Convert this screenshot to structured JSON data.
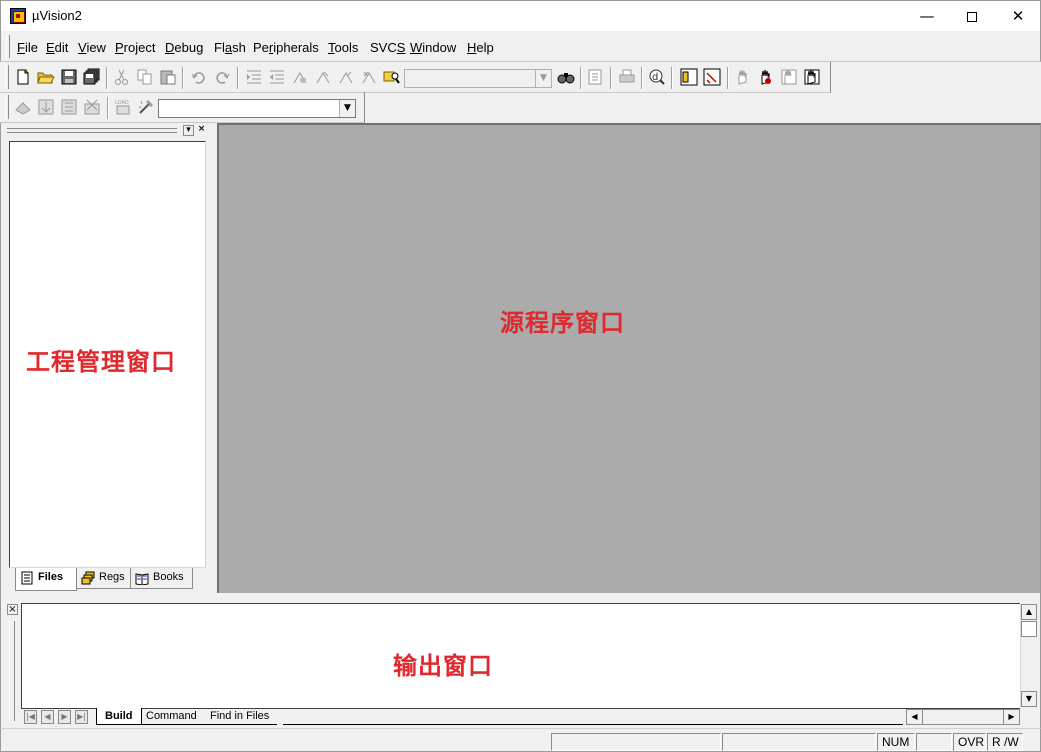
{
  "window": {
    "title": "µVision2",
    "min_glyph": "—",
    "close_glyph": "✕"
  },
  "menu": [
    {
      "key": "F",
      "rest": "ile"
    },
    {
      "key": "E",
      "rest": "dit"
    },
    {
      "key": "V",
      "rest": "iew"
    },
    {
      "key": "P",
      "rest": "roject"
    },
    {
      "key": "D",
      "rest": "ebug"
    },
    {
      "pre": "Fl",
      "key": "a",
      "rest": "sh"
    },
    {
      "pre": "Pe",
      "key": "r",
      "rest": "ipherals"
    },
    {
      "key": "T",
      "rest": "ools"
    },
    {
      "pre": "SVC",
      "key": "S",
      "rest": ""
    },
    {
      "key": "W",
      "rest": "indow"
    },
    {
      "key": "H",
      "rest": "elp"
    }
  ],
  "toolbar": {
    "find_combo_value": "",
    "target_combo_value": "",
    "combo_arrow": "▼"
  },
  "project_panel": {
    "tabs": [
      {
        "label": "Files"
      },
      {
        "label": "Regs"
      },
      {
        "label": "Books"
      }
    ],
    "float_glyph": "▾",
    "close_glyph": "×"
  },
  "labels": {
    "project_window": "工程管理窗口",
    "source_window": "源程序窗口",
    "output_window": "输出窗口"
  },
  "output_panel": {
    "close_glyph": "×",
    "tabs": [
      {
        "label": "Build"
      },
      {
        "label": "Command"
      },
      {
        "label": "Find in Files"
      }
    ],
    "scroll_up": "▲",
    "scroll_down": "▼",
    "scroll_left": "◀",
    "scroll_right": "▶",
    "nav_first": "|◀",
    "nav_prev": "◀",
    "nav_next": "▶",
    "nav_last": "▶|"
  },
  "statusbar": {
    "num": "NUM",
    "ovr": "OVR",
    "rw": "R /W"
  }
}
